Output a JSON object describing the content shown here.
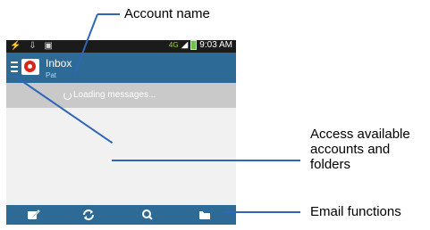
{
  "status_bar": {
    "left_icons": [
      "usb-icon",
      "download-icon",
      "image-icon"
    ],
    "network": "4G",
    "time": "9:03 AM"
  },
  "app_bar": {
    "title": "Inbox",
    "account": "Pat"
  },
  "loading": {
    "text": "Loading messages..."
  },
  "bottom_bar": {
    "buttons": [
      "compose-icon",
      "refresh-icon",
      "search-icon",
      "folder-icon"
    ]
  },
  "callouts": {
    "account_name": "Account name",
    "access_accounts": [
      "Access available",
      "accounts and",
      "folders"
    ],
    "email_functions": "Email functions"
  },
  "colors": {
    "app_bar": "#2e6a96",
    "annotation": "#2f66b8",
    "loading_bar": "#c9c9c9"
  }
}
